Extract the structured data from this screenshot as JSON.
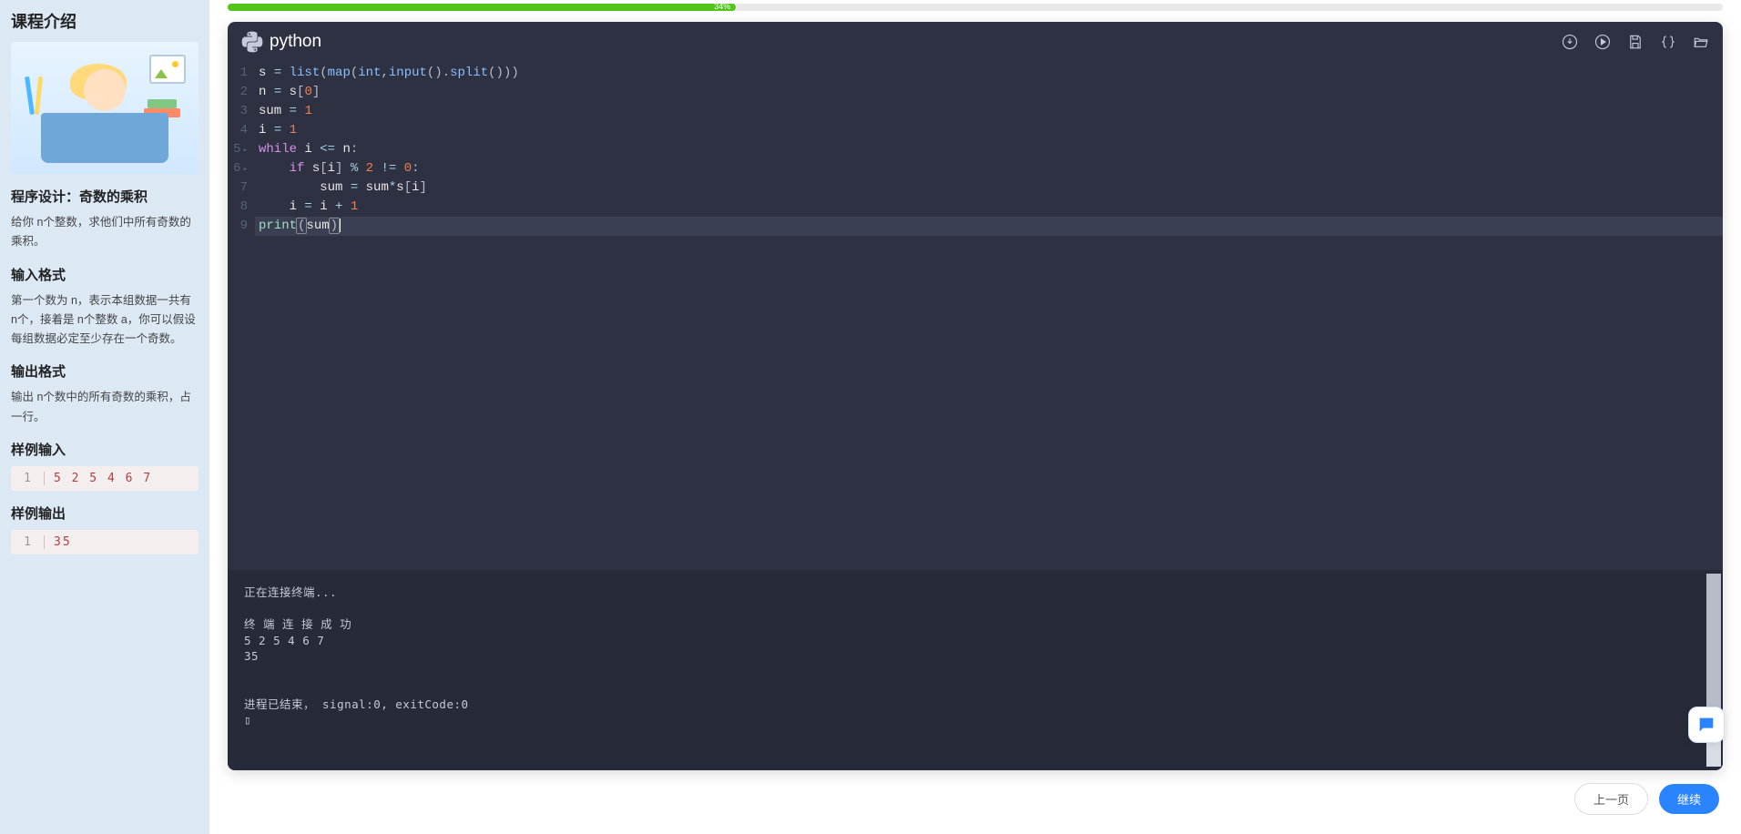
{
  "sidebar": {
    "title": "课程介绍",
    "problem_title": "程序设计：奇数的乘积",
    "problem_desc": "给你 n个整数，求他们中所有奇数的乘积。",
    "input_heading": "输入格式",
    "input_desc": "第一个数为 n，表示本组数据一共有 n个，接着是 n个整数 a，你可以假设每组数据必定至少存在一个奇数。",
    "output_heading": "输出格式",
    "output_desc": "输出 n个数中的所有奇数的乘积，占一行。",
    "sample_in_heading": "样例输入",
    "sample_in": "5 2 5 4 6 7",
    "sample_out_heading": "样例输出",
    "sample_out": "35"
  },
  "progress": {
    "percent": 34,
    "label": "34%"
  },
  "editor": {
    "lang_label": "python",
    "lines": [
      "s = list(map(int,input().split()))",
      "n = s[0]",
      "sum = 1",
      "i = 1",
      "while i <= n:",
      "    if s[i] % 2 != 0:",
      "        sum = sum*s[i]",
      "    i = i + 1",
      "print(sum)"
    ]
  },
  "terminal": {
    "text": "正在连接终端...\n\n终 端 连 接 成 功\n5 2 5 4 6 7\n35\n\n\n进程已结束， signal:0, exitCode:0\n▯"
  },
  "buttons": {
    "prev": "上一页",
    "continue": "继续"
  }
}
